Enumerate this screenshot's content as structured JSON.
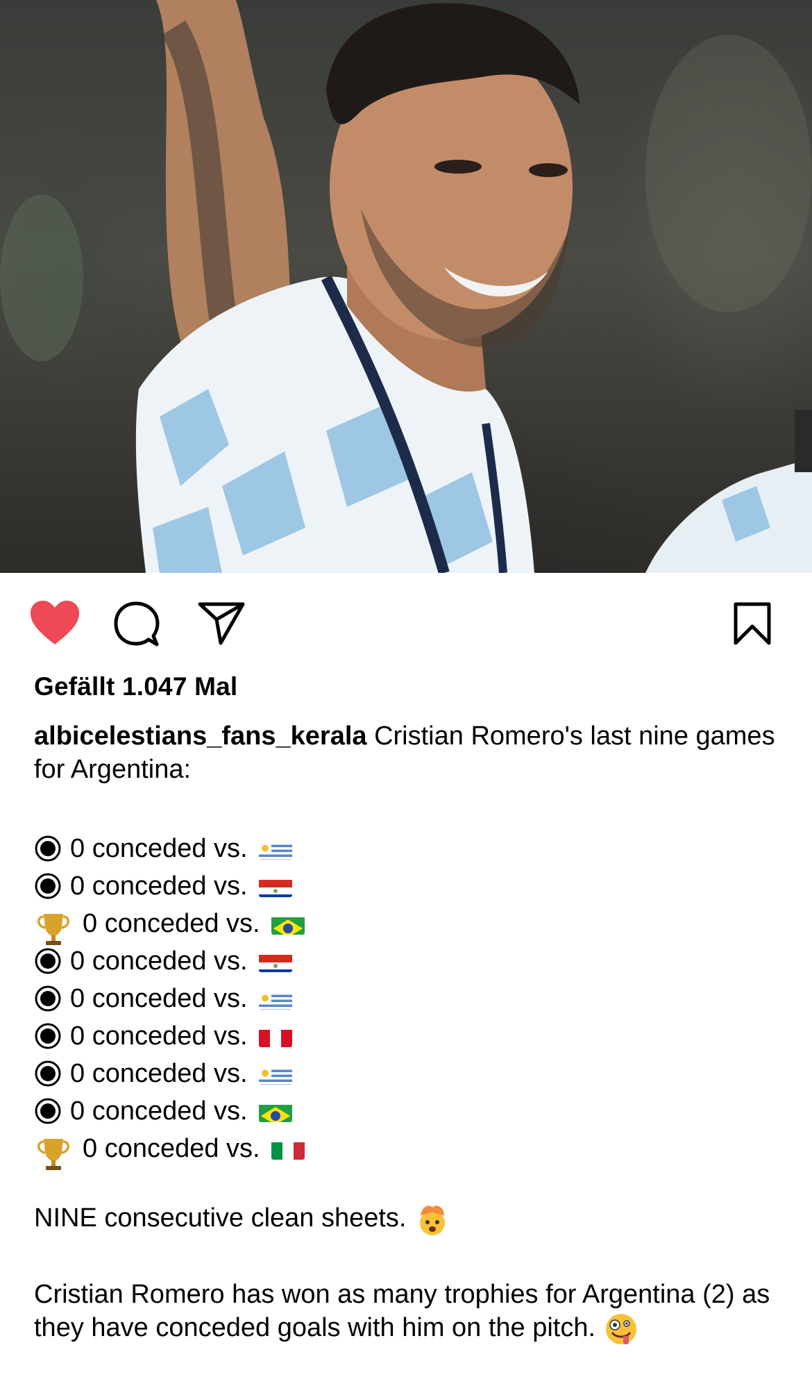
{
  "post": {
    "likes_text": "Gefällt 1.047 Mal",
    "username": "albicelestians_fans_kerala",
    "caption_intro": " Cristian Romero's last nine games for Argentina:",
    "games": [
      {
        "marker": "bullet-icon",
        "text": "0 conceded vs.",
        "flag": "uruguay"
      },
      {
        "marker": "bullet-icon",
        "text": "0 conceded vs.",
        "flag": "paraguay"
      },
      {
        "marker": "trophy-icon",
        "text": "0 conceded vs.",
        "flag": "brazil"
      },
      {
        "marker": "bullet-icon",
        "text": "0 conceded vs.",
        "flag": "paraguay"
      },
      {
        "marker": "bullet-icon",
        "text": "0 conceded vs.",
        "flag": "uruguay"
      },
      {
        "marker": "bullet-icon",
        "text": "0 conceded vs.",
        "flag": "peru"
      },
      {
        "marker": "bullet-icon",
        "text": "0 conceded vs.",
        "flag": "uruguay"
      },
      {
        "marker": "bullet-icon",
        "text": "0 conceded vs.",
        "flag": "brazil"
      },
      {
        "marker": "trophy-icon",
        "text": "0 conceded vs.",
        "flag": "italy"
      }
    ],
    "clean_sheets_text": "NINE consecutive clean sheets.",
    "closing_text": "Cristian Romero has won as many trophies for Argentina (2) as they have conceded goals with him on the pitch."
  },
  "actions": {
    "like_icon": "heart-filled-icon",
    "comment_icon": "comment-icon",
    "share_icon": "send-icon",
    "save_icon": "bookmark-icon",
    "like_color": "#ed4956"
  }
}
